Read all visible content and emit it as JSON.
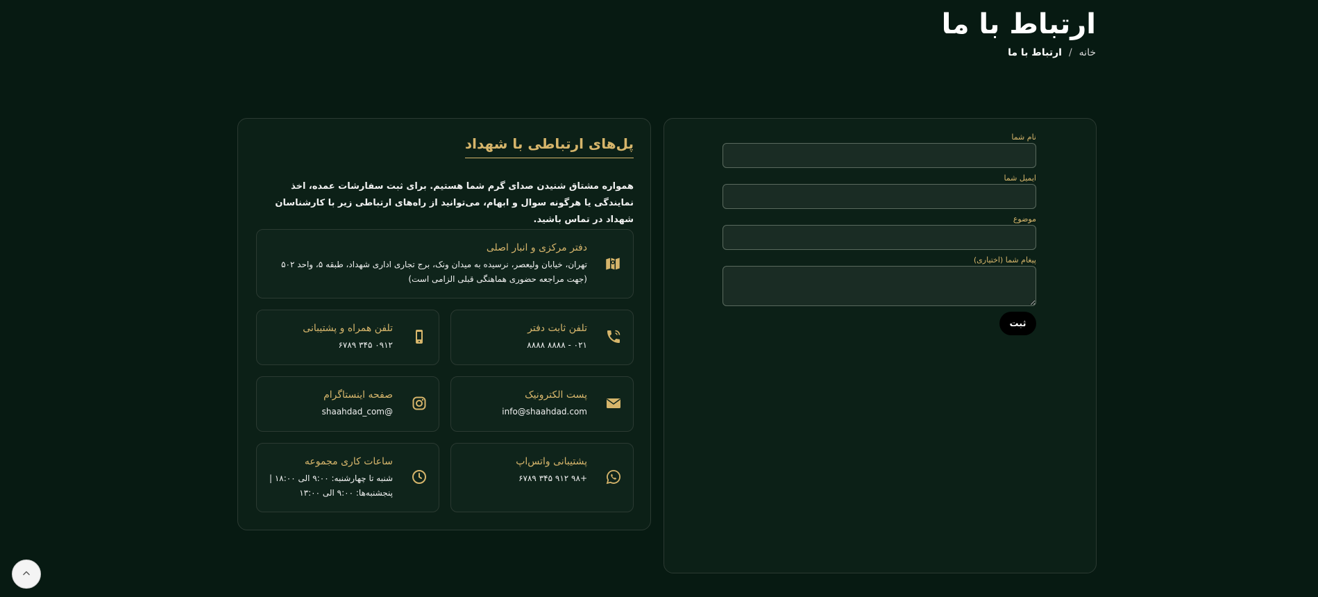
{
  "page": {
    "title": "ارتباط با ما",
    "breadcrumb": {
      "home": "خانه",
      "separator": "/",
      "current": "ارتباط با ما"
    }
  },
  "form": {
    "name_label": "نام شما",
    "email_label": "ایمیل شما",
    "subject_label": "موضوع",
    "message_label": "پیغام شما (اختیاری)",
    "submit_label": "ثبت"
  },
  "info": {
    "title": "پل‌های ارتباطی با شهداد",
    "intro": "همواره مشتاق شنیدن صدای گرم شما هستیم. برای ثبت سفارشات عمده، اخذ نمایندگی یا هرگونه سوال و ابهام، می‌توانید از راه‌های ارتباطی زیر با کارشناسان شهداد در تماس باشید.",
    "office": {
      "title": "دفتر مرکزی و انبار اصلی",
      "text": "تهران، خیابان ولیعصر، نرسیده به میدان ونک، برج تجاری اداری شهداد، طبقه ۵، واحد ۵۰۲ (جهت مراجعه حضوری هماهنگی قبلی الزامی است)",
      "icon": "map-icon"
    },
    "landline": {
      "title": "تلفن ثابت دفتر",
      "text": "۰۲۱ - ۸۸۸۸ ۸۸۸۸",
      "icon": "phone-icon"
    },
    "mobile": {
      "title": "تلفن همراه و پشتیبانی",
      "text": "۰۹۱۲ ۳۴۵ ۶۷۸۹",
      "icon": "mobile-icon"
    },
    "email": {
      "title": "پست الکترونیک",
      "text": "info@shaahdad.com",
      "icon": "envelope-icon"
    },
    "instagram": {
      "title": "صفحه اینستاگرام",
      "text": "@shaahdad_com",
      "icon": "instagram-icon"
    },
    "whatsapp": {
      "title": "پشتیبانی واتس‌اپ",
      "text": "+۹۸ ۹۱۲ ۳۴۵ ۶۷۸۹",
      "icon": "whatsapp-icon"
    },
    "hours": {
      "title": "ساعات کاری مجموعه",
      "line1": "شنبه تا چهارشنبه: ۹:۰۰ الی ۱۸:۰۰ |",
      "line2": "پنجشنبه‌ها: ۹:۰۰ الی ۱۳:۰۰",
      "icon": "clock-icon"
    }
  },
  "colors": {
    "background": "#071a12",
    "accent": "#d6b56b",
    "panel": "#0c2017",
    "border": "#2b3a32"
  }
}
